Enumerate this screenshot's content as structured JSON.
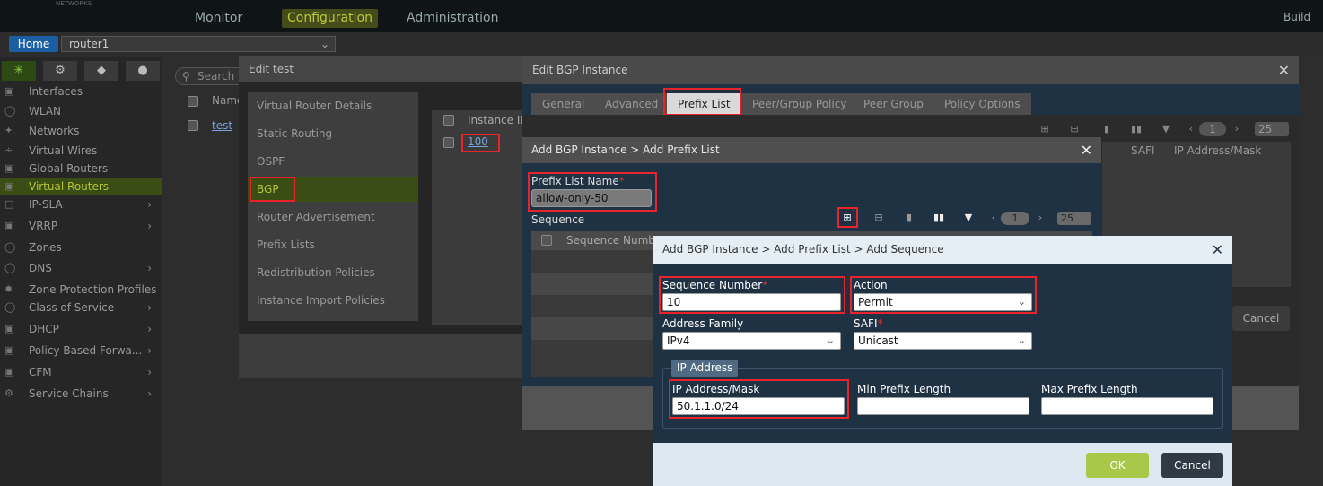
{
  "topnav": {
    "brand": "NETWORKS",
    "tabs": [
      {
        "label": "Monitor",
        "active": false
      },
      {
        "label": "Configuration",
        "active": true
      },
      {
        "label": "Administration",
        "active": false
      }
    ],
    "build": "Build"
  },
  "subbar": {
    "home": "Home",
    "router": "router1"
  },
  "sidebar": {
    "items": [
      {
        "label": "Interfaces",
        "active": false,
        "expandable": false
      },
      {
        "label": "WLAN",
        "active": false,
        "expandable": false
      },
      {
        "label": "Networks",
        "active": false,
        "expandable": false
      },
      {
        "label": "Virtual Wires",
        "active": false,
        "expandable": false
      },
      {
        "label": "Global Routers",
        "active": false,
        "expandable": false
      },
      {
        "label": "Virtual Routers",
        "active": true,
        "expandable": false
      },
      {
        "label": "IP-SLA",
        "active": false,
        "expandable": true
      },
      {
        "label": "VRRP",
        "active": false,
        "expandable": true
      },
      {
        "label": "Zones",
        "active": false,
        "expandable": false
      },
      {
        "label": "DNS",
        "active": false,
        "expandable": true
      },
      {
        "label": "Zone Protection Profiles",
        "active": false,
        "expandable": false
      },
      {
        "label": "Class of Service",
        "active": false,
        "expandable": true
      },
      {
        "label": "DHCP",
        "active": false,
        "expandable": true
      },
      {
        "label": "Policy Based Forwa...",
        "active": false,
        "expandable": true
      },
      {
        "label": "CFM",
        "active": false,
        "expandable": true
      },
      {
        "label": "Service Chains",
        "active": false,
        "expandable": true
      }
    ]
  },
  "background": {
    "search_placeholder": "Search",
    "col_name": "Name",
    "row_name": "test"
  },
  "edit_test": {
    "title": "Edit test",
    "menu": [
      {
        "label": "Virtual Router Details",
        "active": false
      },
      {
        "label": "Static Routing",
        "active": false
      },
      {
        "label": "OSPF",
        "active": false
      },
      {
        "label": "BGP",
        "active": true
      },
      {
        "label": "Router Advertisement",
        "active": false
      },
      {
        "label": "Prefix Lists",
        "active": false
      },
      {
        "label": "Redistribution Policies",
        "active": false
      },
      {
        "label": "Instance Import Policies",
        "active": false
      }
    ],
    "grid_col": "Instance ID",
    "grid_value": "100"
  },
  "edit_bgp": {
    "title": "Edit BGP Instance",
    "tabs": [
      {
        "label": "General",
        "active": false
      },
      {
        "label": "Advanced",
        "active": false
      },
      {
        "label": "Prefix List",
        "active": true
      },
      {
        "label": "Peer/Group Policy",
        "active": false
      },
      {
        "label": "Peer Group",
        "active": false
      },
      {
        "label": "Policy Options",
        "active": false
      }
    ],
    "grid_cols": [
      "SAFI",
      "IP Address/Mask"
    ],
    "page": "1",
    "page_size": "25",
    "cancel": "Cancel"
  },
  "add_prefix_list": {
    "title": "Add BGP Instance > Add Prefix List",
    "name_label": "Prefix List Name",
    "name_value": "allow-only-50",
    "sequence_label": "Sequence",
    "grid_col": "Sequence Number",
    "page": "1",
    "page_size": "25"
  },
  "add_sequence": {
    "title": "Add BGP Instance > Add Prefix List > Add Sequence",
    "sequence_number_label": "Sequence Number",
    "sequence_number_value": "10",
    "action_label": "Action",
    "action_value": "Permit",
    "address_family_label": "Address Family",
    "address_family_value": "IPv4",
    "safi_label": "SAFI",
    "safi_value": "Unicast",
    "ip_group_title": "IP Address",
    "ip_mask_label": "IP Address/Mask",
    "ip_mask_value": "50.1.1.0/24",
    "min_prefix_label": "Min Prefix Length",
    "min_prefix_value": "",
    "max_prefix_label": "Max Prefix Length",
    "max_prefix_value": "",
    "ok": "OK",
    "cancel": "Cancel",
    "required_mark": "*"
  },
  "icons": {
    "close": "close-icon",
    "chevron": "chevron-down-icon",
    "add": "plus-icon",
    "filter": "filter-icon",
    "columns": "columns-icon"
  },
  "colors": {
    "highlight": "#e8232a",
    "ok_button": "#a8c84a",
    "active_nav": "#b9cb3a"
  }
}
